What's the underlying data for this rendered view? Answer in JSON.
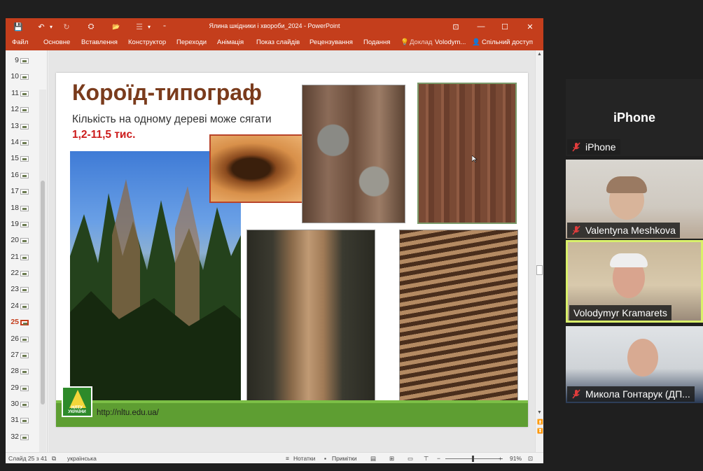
{
  "window": {
    "title": "Ялина шкідники і хвороби_2024 - PowerPoint",
    "controls": {
      "ribbon_display": "⊡",
      "minimize": "—",
      "maximize": "☐",
      "close": "✕"
    }
  },
  "quick_access": {
    "save": "💾",
    "undo": "↶",
    "undo_more": "▾",
    "redo": "↻",
    "presenter": "⛭",
    "open": "📂",
    "bullets": "☰",
    "more": "▾",
    "customize": "⁼"
  },
  "ribbon": {
    "tabs": [
      "Файл",
      "Основне",
      "Вставлення",
      "Конструктор",
      "Переходи",
      "Анімація",
      "Показ слайдів",
      "Рецензування",
      "Подання"
    ],
    "tell_me": "Доклад",
    "tell_icon": "💡",
    "user": "Volodym...",
    "share": "Спільний доступ",
    "share_icon": "👤"
  },
  "thumbnails": {
    "numbers": [
      "9",
      "10",
      "11",
      "12",
      "13",
      "14",
      "15",
      "16",
      "17",
      "18",
      "19",
      "20",
      "21",
      "22",
      "23",
      "24",
      "25",
      "26",
      "27",
      "28",
      "29",
      "30",
      "31",
      "32"
    ],
    "active": "25"
  },
  "slide": {
    "title": "Короїд-типограф",
    "subtitle": "Кількість на одному дереві може сягати",
    "number_text": "1,2-11,5 тис.",
    "url": "http://nltu.edu.ua/",
    "logo_text_1": "НЛТУ",
    "logo_text_2": "УКРАЇНИ"
  },
  "statusbar": {
    "slide_count": "Слайд 25 з 41",
    "language": "українська",
    "notes": "Нотатки",
    "comments": "Примітки",
    "zoom_minus": "−",
    "zoom_plus": "+",
    "zoom": "91%",
    "fit_icon": "⊡"
  },
  "participants": [
    {
      "name": "iPhone",
      "big_label": "iPhone",
      "muted": true
    },
    {
      "name": "Valentyna Meshkova",
      "muted": true
    },
    {
      "name": "Volodymyr Kramarets",
      "muted": false,
      "active_speaker": true
    },
    {
      "name": "Микола Гонтарук (ДП...",
      "muted": true
    }
  ],
  "colors": {
    "ppt_accent": "#c43e1c",
    "slide_title": "#7a3b1c",
    "slide_number": "#cc1b1b",
    "band_green": "#5e9e32",
    "speaker_border": "#d9f06a"
  }
}
